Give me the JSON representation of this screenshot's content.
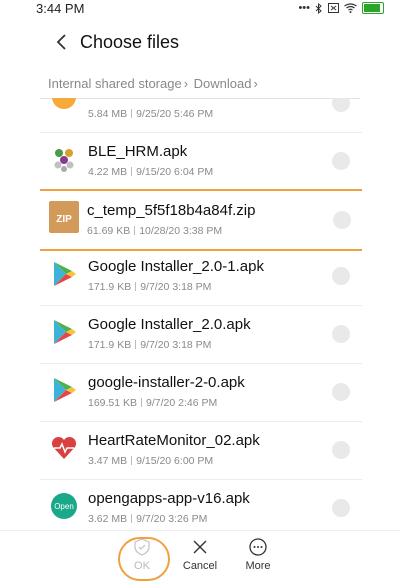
{
  "status_bar": {
    "time": "3:44 PM",
    "icons": [
      "more-dots-icon",
      "bluetooth-icon",
      "mute-icon",
      "wifi-icon",
      "battery-icon"
    ]
  },
  "header": {
    "title": "Choose files"
  },
  "breadcrumb": {
    "items": [
      "Internal shared storage",
      "Download"
    ]
  },
  "files": [
    {
      "name": "",
      "size": "5.84 MB",
      "date": "9/25/20 5:46 PM",
      "icon": "partial-file-icon",
      "selected": false
    },
    {
      "name": "BLE_HRM.apk",
      "size": "4.22 MB",
      "date": "9/15/20 6:04 PM",
      "icon": "apk-molecule-icon",
      "selected": false
    },
    {
      "name": "c_temp_5f5f18b4a84f.zip",
      "size": "61.69 KB",
      "date": "10/28/20 3:38 PM",
      "icon": "zip-icon",
      "icon_text": "ZIP",
      "selected": true
    },
    {
      "name": "Google Installer_2.0-1.apk",
      "size": "171.9 KB",
      "date": "9/7/20 3:18 PM",
      "icon": "play-store-icon",
      "selected": false
    },
    {
      "name": "Google Installer_2.0.apk",
      "size": "171.9 KB",
      "date": "9/7/20 3:18 PM",
      "icon": "play-store-icon",
      "selected": false
    },
    {
      "name": "google-installer-2-0.apk",
      "size": "169.51 KB",
      "date": "9/7/20 2:46 PM",
      "icon": "play-store-icon",
      "selected": false
    },
    {
      "name": "HeartRateMonitor_02.apk",
      "size": "3.47 MB",
      "date": "9/15/20 6:00 PM",
      "icon": "heart-rate-icon",
      "selected": false
    },
    {
      "name": "opengapps-app-v16.apk",
      "size": "3.62 MB",
      "date": "9/7/20 3:26 PM",
      "icon": "opengapps-icon",
      "icon_text": "Open",
      "selected": false
    }
  ],
  "bottom_bar": {
    "ok_label": "OK",
    "cancel_label": "Cancel",
    "more_label": "More"
  },
  "colors": {
    "highlight": "#f0a040",
    "zip": "#d49a5a",
    "heart": "#d94040",
    "opengapps": "#1aa88a",
    "battery": "#2aa52a"
  }
}
